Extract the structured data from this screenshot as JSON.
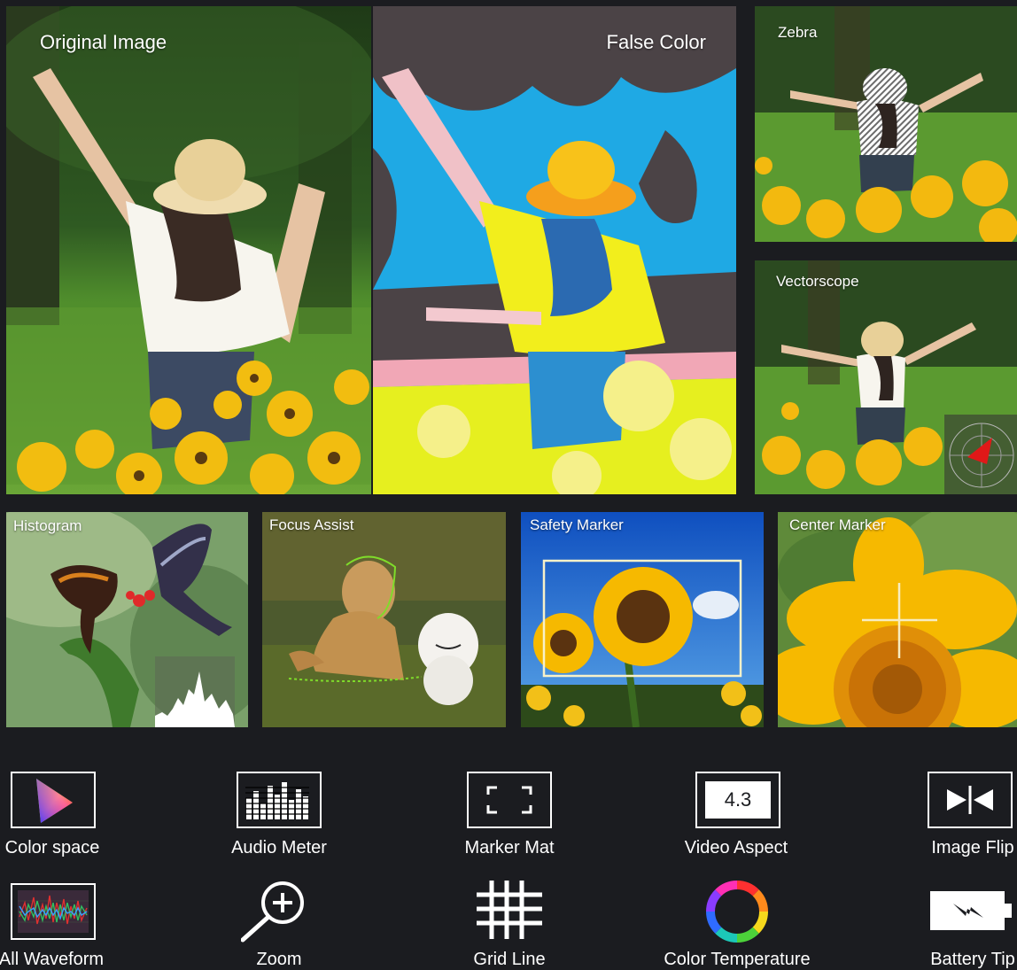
{
  "tiles": {
    "original": {
      "label": "Original Image"
    },
    "false_color": {
      "label": "False Color"
    },
    "zebra": {
      "label": "Zebra"
    },
    "vectorscope": {
      "label": "Vectorscope"
    },
    "histogram": {
      "label": "Histogram"
    },
    "focus_assist": {
      "label": "Focus Assist"
    },
    "safety_marker": {
      "label": "Safety Marker"
    },
    "center_marker": {
      "label": "Center Marker"
    }
  },
  "features": {
    "row1": [
      {
        "label": "Color space",
        "icon": "color-space-icon"
      },
      {
        "label": "Audio Meter",
        "icon": "audio-meter-icon"
      },
      {
        "label": "Marker Mat",
        "icon": "marker-mat-icon"
      },
      {
        "label": "Video Aspect",
        "icon": "video-aspect-icon",
        "icon_text": "4.3"
      },
      {
        "label": "Image Flip",
        "icon": "image-flip-icon"
      }
    ],
    "row2": [
      {
        "label": "All Waveform",
        "icon": "waveform-icon"
      },
      {
        "label": "Zoom",
        "icon": "zoom-icon"
      },
      {
        "label": "Grid Line",
        "icon": "grid-line-icon"
      },
      {
        "label": "Color Temperature",
        "icon": "color-temperature-icon"
      },
      {
        "label": "Battery Tip",
        "icon": "battery-tip-icon"
      }
    ]
  },
  "colors": {
    "background": "#1b1c20",
    "false_color_blue": "#1fa9e4",
    "false_color_yellow": "#f2ee1c",
    "false_color_gray": "#4b4346",
    "sunflower": "#f6b900",
    "sky_blue": "#1f62c9"
  }
}
